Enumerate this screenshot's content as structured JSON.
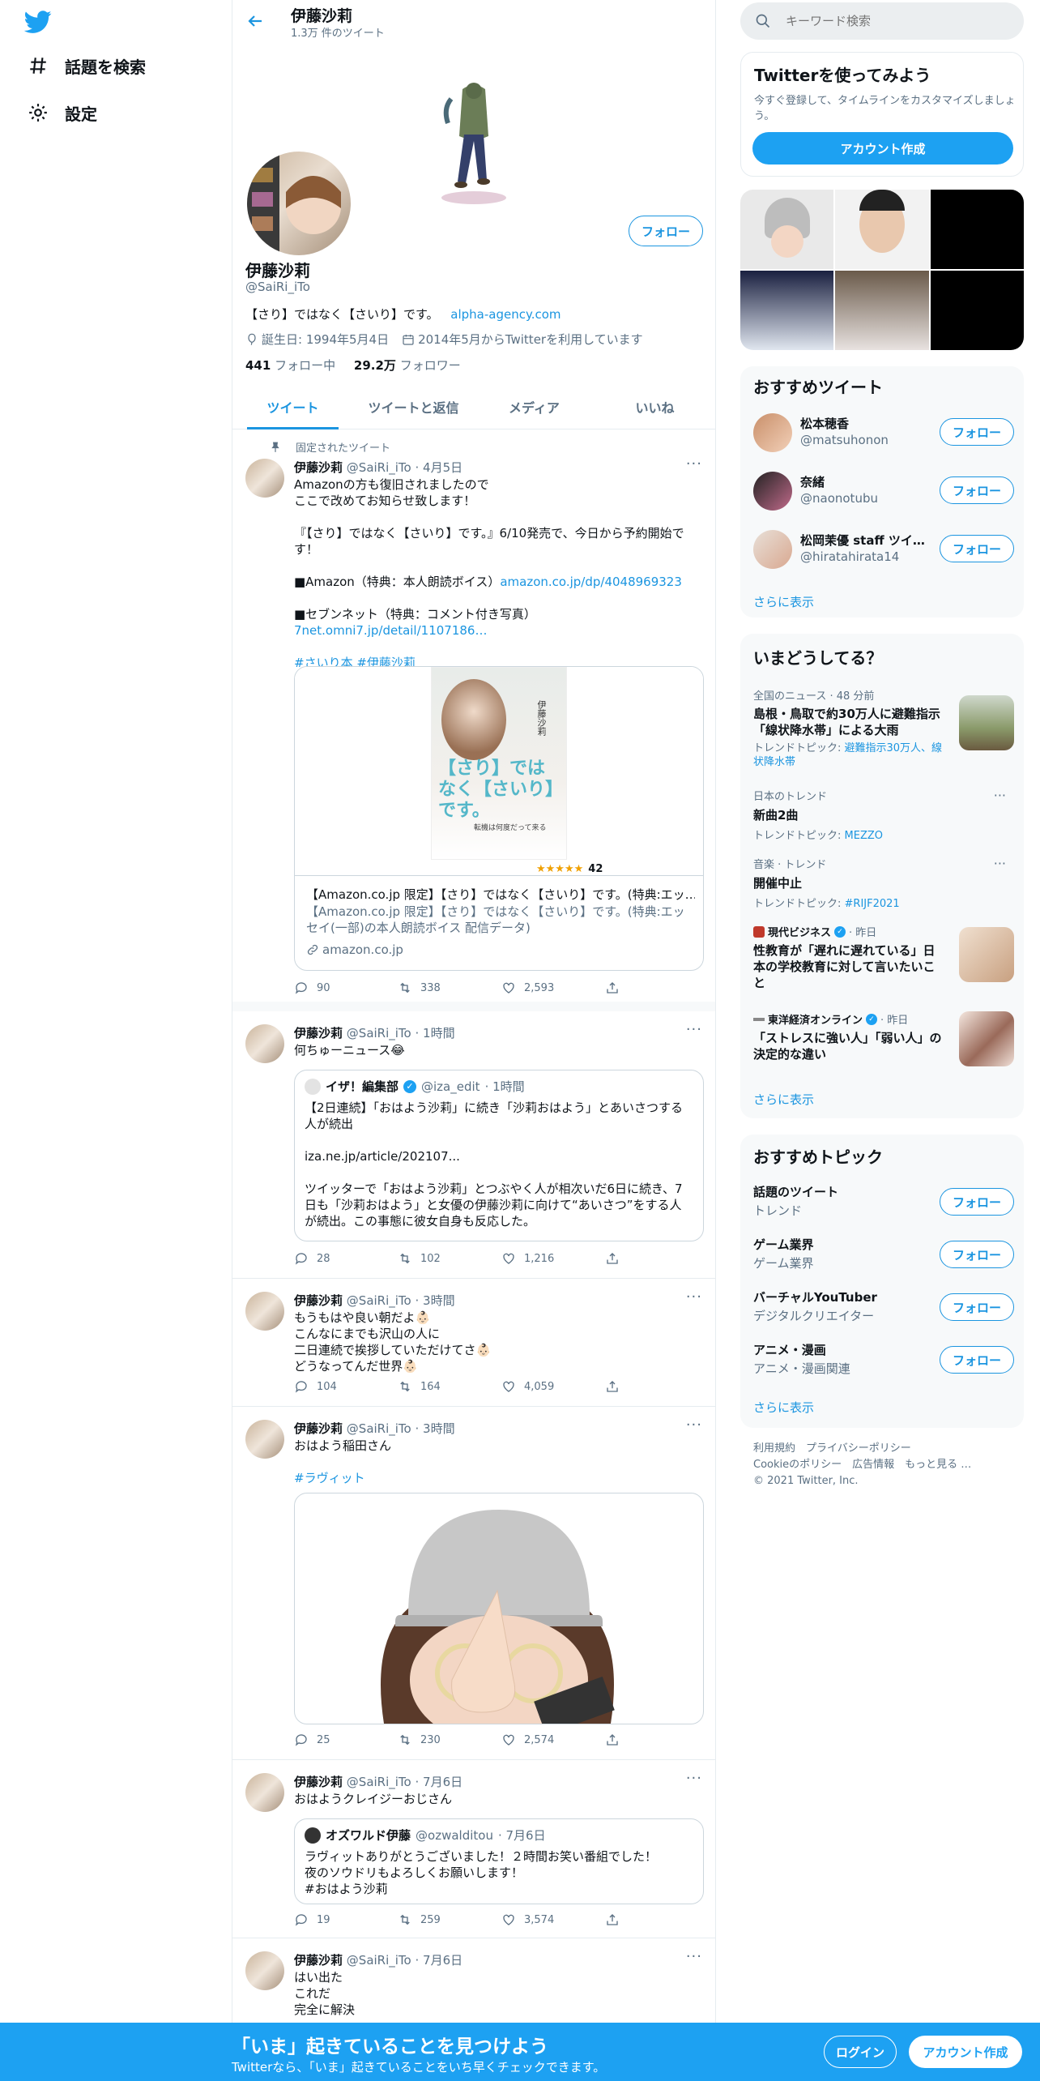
{
  "nav": {
    "explore": "話題を検索",
    "settings": "設定"
  },
  "header": {
    "name": "伊藤沙莉",
    "tweet_count": "1.3万 件のツイート"
  },
  "profile": {
    "name": "伊藤沙莉",
    "handle": "@SaiRi_iTo",
    "bio": "【さり】ではなく【さいり】です。",
    "bio_link": "alpha-agency.com",
    "birthday": "誕生日: 1994年5月4日",
    "joined": "2014年5月からTwitterを利用しています",
    "following_count": "441",
    "following_label": "フォロー中",
    "followers_count": "29.2万",
    "followers_label": "フォロワー",
    "follow_button": "フォロー"
  },
  "tabs": [
    "ツイート",
    "ツイートと返信",
    "メディア",
    "いいね"
  ],
  "tweets": [
    {
      "pinned": "固定されたツイート",
      "name": "伊藤沙莉",
      "handle": "@SaiRi_iTo",
      "time": "· 4月5日",
      "lines": [
        "Amazonの方も復旧されましたので",
        "ここで改めてお知らせ致します！",
        "",
        "『【さり】ではなく【さいり】です。』6/10発売で、今日から予約開始です！",
        "",
        "■Amazon（特典：本人朗読ボイス）",
        "",
        "■セブンネット（特典：コメント付き写真）"
      ],
      "link1": "amazon.co.jp/dp/4048969323",
      "link2": "7net.omni7.jp/detail/1107186…",
      "hashtags": "#さいり本 #伊藤沙莉",
      "card_title": "【Amazon.co.jp 限定】【さり】ではなく【さいり】です。(特典:エッ…",
      "card_desc": "【Amazon.co.jp 限定】【さり】ではなく【さいり】です。(特典:エッセイ(一部)の本人朗読ボイス 配信データ)",
      "card_domain": "amazon.co.jp",
      "book_text": "【さり】ではなく【さいり】です。",
      "book_sub": "転機は何度だって来る",
      "book_author": "伊藤沙莉",
      "rating_count": "42",
      "reply": "90",
      "retweet": "338",
      "like": "2,593"
    },
    {
      "name": "伊藤沙莉",
      "handle": "@SaiRi_iTo",
      "time": "· 1時間",
      "text": "何ちゅーニュース😂",
      "quote_name": "イザ！編集部",
      "quote_handle": "@iza_edit",
      "quote_time": "· 1時間",
      "quote_lines": [
        "【2日連続】「おはよう沙莉」に続き「沙莉おはよう」とあいさつする人が続出",
        "",
        "iza.ne.jp/article/202107...",
        "",
        "ツイッターで「おはよう沙莉」とつぶやく人が相次いだ6日に続き、7日も「沙莉おはよう」と女優の伊藤沙莉に向けて“あいさつ”をする人が続出。この事態に彼女自身も反応した。"
      ],
      "reply": "28",
      "retweet": "102",
      "like": "1,216"
    },
    {
      "name": "伊藤沙莉",
      "handle": "@SaiRi_iTo",
      "time": "· 3時間",
      "lines": [
        "もうもはや良い朝だよ👶🏻",
        "こんなにまでも沢山の人に",
        "二日連続で挨拶していただけてさ👶🏻",
        "どうなってんだ世界👶🏻"
      ],
      "reply": "104",
      "retweet": "164",
      "like": "4,059"
    },
    {
      "name": "伊藤沙莉",
      "handle": "@SaiRi_iTo",
      "time": "· 3時間",
      "text": "おはよう稲田さん",
      "hashtag": "#ラヴィット",
      "reply": "25",
      "retweet": "230",
      "like": "2,574"
    },
    {
      "name": "伊藤沙莉",
      "handle": "@SaiRi_iTo",
      "time": "· 7月6日",
      "text": "おはようクレイジーおじさん",
      "quote_name": "オズワルド伊藤",
      "quote_handle": "@ozwalditou",
      "quote_time": "· 7月6日",
      "quote_lines": [
        "ラヴィットありがとうございました！２時間お笑い番組でした！",
        "夜のソウドリもよろしくお願いします！",
        "#おはよう沙莉"
      ],
      "reply": "19",
      "retweet": "259",
      "like": "3,574"
    },
    {
      "name": "伊藤沙莉",
      "handle": "@SaiRi_iTo",
      "time": "· 7月6日",
      "lines": [
        "はい出た",
        "これだ",
        "完全に解決"
      ]
    }
  ],
  "right": {
    "search_placeholder": "キーワード検索",
    "signup": {
      "title": "Twitterを使ってみよう",
      "desc": "今すぐ登録して、タイムラインをカスタマイズしましょう。",
      "button": "アカウント作成"
    },
    "who_to_follow": {
      "title": "おすすめツイート",
      "users": [
        {
          "name": "松本穂香",
          "handle": "@matsuhonon",
          "button": "フォロー"
        },
        {
          "name": "奈緒",
          "handle": "@naonotubu",
          "button": "フォロー"
        },
        {
          "name": "松岡茉優 staff ツイ…",
          "handle": "@hiratahirata14",
          "button": "フォロー"
        }
      ],
      "show_more": "さらに表示"
    },
    "trends": {
      "title": "いまどうしてる？",
      "items": [
        {
          "context": "全国のニュース · 48 分前",
          "title": "島根・鳥取で約30万人に避難指示「線状降水帯」による大雨",
          "meta_prefix": "トレンドトピック: ",
          "meta_link": "避難指示30万人、線状降水帯"
        },
        {
          "context": "日本のトレンド",
          "title": "新曲2曲",
          "meta_prefix": "トレンドトピック: ",
          "meta_link": "MEZZO"
        },
        {
          "context": "音楽 · トレンド",
          "title": "開催中止",
          "meta_prefix": "トレンドトピック: ",
          "meta_link": "#RIJF2021"
        },
        {
          "context_source": "現代ビジネス",
          "context_time": "· 昨日",
          "title": "性教育が「遅れに遅れている」日本の学校教育に対して言いたいこと"
        },
        {
          "context_source": "東洋経済オンライン",
          "context_time": "· 昨日",
          "title": "「ストレスに強い人」「弱い人」の決定的な違い"
        }
      ],
      "show_more": "さらに表示"
    },
    "topics": {
      "title": "おすすめトピック",
      "items": [
        {
          "name": "話題のツイート",
          "category": "トレンド",
          "button": "フォロー"
        },
        {
          "name": "ゲーム業界",
          "category": "ゲーム業界",
          "button": "フォロー"
        },
        {
          "name": "バーチャルYouTuber",
          "category": "デジタルクリエイター",
          "button": "フォロー"
        },
        {
          "name": "アニメ・漫画",
          "category": "アニメ・漫画関連",
          "button": "フォロー"
        }
      ],
      "show_more": "さらに表示"
    },
    "footer": {
      "terms": "利用規約",
      "privacy": "プライバシーポリシー",
      "cookie": "Cookieのポリシー",
      "ads": "広告情報",
      "more": "もっと見る …",
      "copyright": "© 2021 Twitter, Inc."
    }
  },
  "bottom": {
    "title": "「いま」起きていることを見つけよう",
    "sub": "Twitterなら、「いま」起きていることをいち早くチェックできます。",
    "login": "ログイン",
    "signup": "アカウント作成"
  }
}
